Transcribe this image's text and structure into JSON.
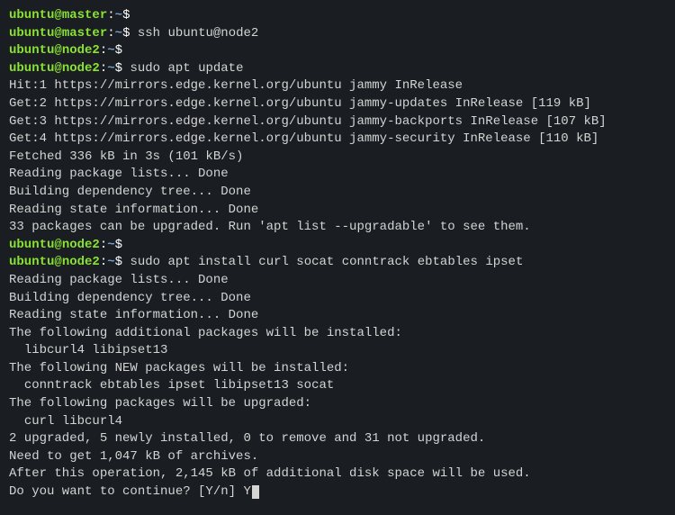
{
  "lines": [
    {
      "type": "prompt",
      "user": "ubuntu",
      "host": "master",
      "path": "~",
      "cmd": ""
    },
    {
      "type": "prompt",
      "user": "ubuntu",
      "host": "master",
      "path": "~",
      "cmd": "ssh ubuntu@node2"
    },
    {
      "type": "prompt",
      "user": "ubuntu",
      "host": "node2",
      "path": "~",
      "cmd": ""
    },
    {
      "type": "prompt",
      "user": "ubuntu",
      "host": "node2",
      "path": "~",
      "cmd": "sudo apt update"
    },
    {
      "type": "output",
      "text": "Hit:1 https://mirrors.edge.kernel.org/ubuntu jammy InRelease"
    },
    {
      "type": "output",
      "text": "Get:2 https://mirrors.edge.kernel.org/ubuntu jammy-updates InRelease [119 kB]"
    },
    {
      "type": "output",
      "text": "Get:3 https://mirrors.edge.kernel.org/ubuntu jammy-backports InRelease [107 kB]"
    },
    {
      "type": "output",
      "text": "Get:4 https://mirrors.edge.kernel.org/ubuntu jammy-security InRelease [110 kB]"
    },
    {
      "type": "output",
      "text": "Fetched 336 kB in 3s (101 kB/s)"
    },
    {
      "type": "output",
      "text": "Reading package lists... Done"
    },
    {
      "type": "output",
      "text": "Building dependency tree... Done"
    },
    {
      "type": "output",
      "text": "Reading state information... Done"
    },
    {
      "type": "output",
      "text": "33 packages can be upgraded. Run 'apt list --upgradable' to see them."
    },
    {
      "type": "prompt",
      "user": "ubuntu",
      "host": "node2",
      "path": "~",
      "cmd": ""
    },
    {
      "type": "prompt",
      "user": "ubuntu",
      "host": "node2",
      "path": "~",
      "cmd": "sudo apt install curl socat conntrack ebtables ipset"
    },
    {
      "type": "output",
      "text": "Reading package lists... Done"
    },
    {
      "type": "output",
      "text": "Building dependency tree... Done"
    },
    {
      "type": "output",
      "text": "Reading state information... Done"
    },
    {
      "type": "output",
      "text": "The following additional packages will be installed:"
    },
    {
      "type": "output",
      "text": "  libcurl4 libipset13"
    },
    {
      "type": "output",
      "text": "The following NEW packages will be installed:"
    },
    {
      "type": "output",
      "text": "  conntrack ebtables ipset libipset13 socat"
    },
    {
      "type": "output",
      "text": "The following packages will be upgraded:"
    },
    {
      "type": "output",
      "text": "  curl libcurl4"
    },
    {
      "type": "output",
      "text": "2 upgraded, 5 newly installed, 0 to remove and 31 not upgraded."
    },
    {
      "type": "output",
      "text": "Need to get 1,047 kB of archives."
    },
    {
      "type": "output",
      "text": "After this operation, 2,145 kB of additional disk space will be used."
    },
    {
      "type": "input",
      "text": "Do you want to continue? [Y/n] ",
      "answer": "Y"
    }
  ]
}
